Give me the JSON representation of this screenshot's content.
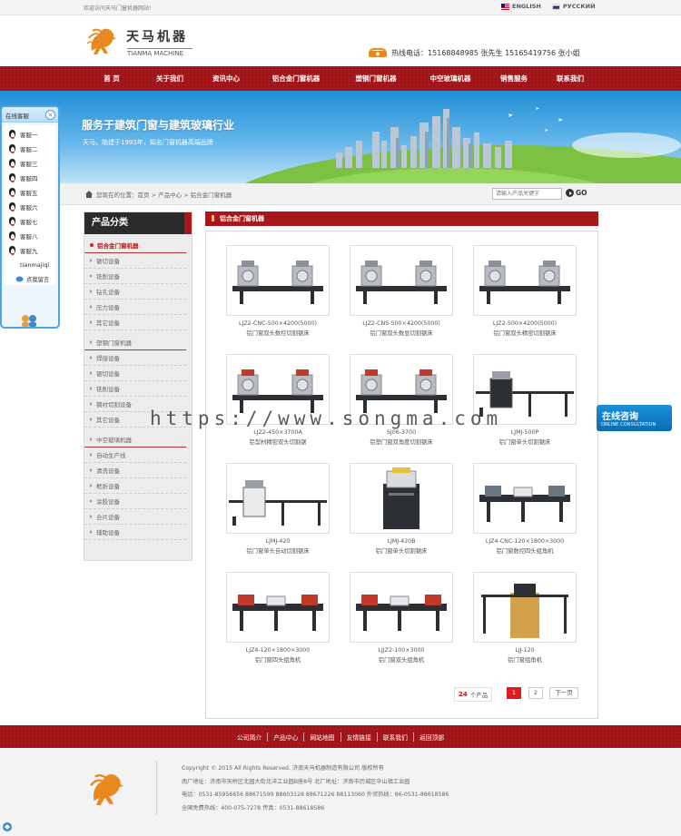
{
  "topbar": {
    "welcome": "欢迎访问天马门窗机器网站！",
    "lang_en": "ENGLISH",
    "lang_ru": "РУССКИЙ"
  },
  "header": {
    "logo_cn": "天马机器",
    "logo_en": "TIANMA MACHINE",
    "hotline": "热线电话：15168848985 张先生   15165419756 张小姐"
  },
  "nav": [
    "首    页",
    "关于我们",
    "资讯中心",
    "铝合金门窗机器",
    "塑钢门窗机器",
    "中空玻璃机器",
    "销售服务",
    "联系我们"
  ],
  "banner": {
    "slogan": "服务于建筑门窗与建筑玻璃行业",
    "sub": "天马，始建于1993年，知名门窗机器高端品牌"
  },
  "breadcrumb": {
    "text": "您现在的位置：首页 > 产品中心 > 铝合金门窗机器",
    "search_placeholder": "请输入产品关键字",
    "go": "GO"
  },
  "categories": {
    "title": "产品分类",
    "items": [
      {
        "label": "铝合金门窗机器",
        "kind": "group",
        "active": true
      },
      {
        "label": "锯切设备",
        "kind": "sub"
      },
      {
        "label": "铣削设备",
        "kind": "sub"
      },
      {
        "label": "钻孔设备",
        "kind": "sub"
      },
      {
        "label": "压力设备",
        "kind": "sub"
      },
      {
        "label": "其它设备",
        "kind": "sub"
      },
      {
        "label": "塑钢门窗机器",
        "kind": "group"
      },
      {
        "label": "焊接设备",
        "kind": "sub"
      },
      {
        "label": "锯切设备",
        "kind": "sub"
      },
      {
        "label": "铣削设备",
        "kind": "sub"
      },
      {
        "label": "钢衬切割设备",
        "kind": "sub"
      },
      {
        "label": "其它设备",
        "kind": "sub"
      },
      {
        "label": "中空玻璃机器",
        "kind": "group"
      },
      {
        "label": "自动生产线",
        "kind": "sub"
      },
      {
        "label": "清洗设备",
        "kind": "sub"
      },
      {
        "label": "框折设备",
        "kind": "sub"
      },
      {
        "label": "涂胶设备",
        "kind": "sub"
      },
      {
        "label": "合片设备",
        "kind": "sub"
      },
      {
        "label": "辅助设备",
        "kind": "sub"
      }
    ]
  },
  "main": {
    "title": "铝合金门窗机器",
    "products": [
      {
        "model": "LJZ2-CNC-500×4200(5000)",
        "name": "铝门窗双头数控切割锯床",
        "type": "double-saw"
      },
      {
        "model": "LJZ2-CNS-500×4200(5000)",
        "name": "铝门窗双头数显切割锯床",
        "type": "double-saw"
      },
      {
        "model": "LJZ2-500×4200(5000)",
        "name": "铝门窗双头精密切割锯床",
        "type": "double-saw"
      },
      {
        "model": "LJZ2-450×3700A",
        "name": "铝型材精密双头切割锯",
        "type": "double-saw-red"
      },
      {
        "model": "SJ06-3700",
        "name": "铝塑门窗双角度切割锯床",
        "type": "double-saw-red"
      },
      {
        "model": "LJMJ-500P",
        "name": "铝门窗单头切割锯床",
        "type": "single-saw"
      },
      {
        "model": "LJMJ-420",
        "name": "铝门窗单头自动切割锯床",
        "type": "single-saw-white"
      },
      {
        "model": "LJMJ-420B",
        "name": "铝门窗单头切割锯床",
        "type": "cabinet"
      },
      {
        "model": "LJZ4-CNC-120×1800×3000",
        "name": "铝门窗数控四头组角机",
        "type": "crimper"
      },
      {
        "model": "LJZ4-120×1800×3000",
        "name": "铝门窗四头组角机",
        "type": "crimper-red"
      },
      {
        "model": "LJJZ2-100×3000",
        "name": "铝门窗双头组角机",
        "type": "crimper-red"
      },
      {
        "model": "LJJ-120",
        "name": "铝门窗组角机",
        "type": "single-crimper"
      }
    ],
    "pager": {
      "total": "24",
      "total_label": "个产品",
      "pages": [
        "1",
        "2"
      ],
      "current": "1",
      "next": "下一页"
    }
  },
  "footer": {
    "links": [
      "公司简介",
      "产品中心",
      "网站地图",
      "友情链接",
      "联系我们",
      "返回顶部"
    ],
    "lines": [
      "Copyright © 2015   All Rights Reserved.   济南天马机器制造有限公司   版权所有",
      "南厂地址：济南市天桥区北园大街北洋工业园B座8号   北厂地址：济南市历城区华山镇工业园",
      "电话：0531-85956656 88671599 88603128 88671226 88113060   外贸热线：86-0531-88618586",
      "全国免费热线：400-075-7278   传真：0531-88618586"
    ]
  },
  "qq_panel": {
    "title": "在线客服",
    "items": [
      "客服一",
      "客服二",
      "客服三",
      "客服四",
      "客服五",
      "客服六",
      "客服七",
      "客服八",
      "客服九"
    ],
    "plain": "tianmajiqi",
    "msg": "点我留言"
  },
  "consult": {
    "title": "在线咨询",
    "sub": "ONLINE CONSULTATION"
  },
  "watermark": "https://www.songma.com",
  "colors": {
    "brand_red": "#a8171c",
    "accent_blue": "#1a8fd8"
  }
}
